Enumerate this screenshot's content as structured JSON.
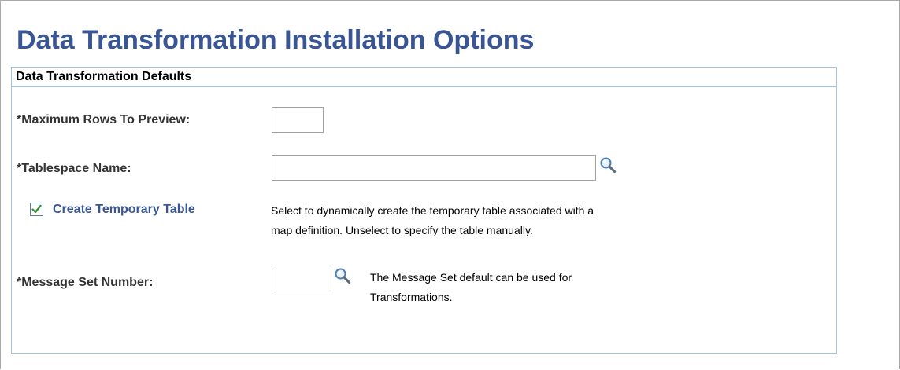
{
  "page": {
    "title": "Data Transformation Installation Options"
  },
  "group": {
    "header": "Data Transformation Defaults"
  },
  "fields": {
    "max_rows": {
      "label": "*Maximum Rows To Preview:",
      "value": ""
    },
    "tablespace": {
      "label": "*Tablespace Name:",
      "value": ""
    },
    "create_temp": {
      "label": "Create Temporary Table",
      "checked": true,
      "help_line1": "Select to dynamically create the temporary table associated with a",
      "help_line2": "map definition. Unselect to specify the table manually."
    },
    "message_set": {
      "label": "*Message Set Number:",
      "value": "",
      "help_line1": "The Message Set default can be used for",
      "help_line2": "Transformations."
    }
  },
  "icons": {
    "lookup": "magnifying-glass-icon",
    "checkmark": "checkmark-icon"
  },
  "colors": {
    "title": "#3a5594",
    "group_border": "#a7c1d6",
    "checkmark": "#2e8b2e"
  }
}
